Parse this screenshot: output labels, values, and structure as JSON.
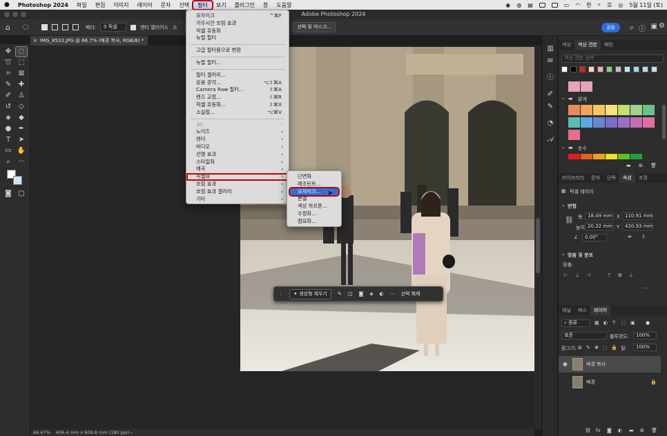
{
  "mac_menu": {
    "apple": "",
    "items": [
      "Photoshop 2024",
      "파일",
      "편집",
      "이미지",
      "레이어",
      "문자",
      "선택",
      "필터",
      "보기",
      "플러그인",
      "창",
      "도움말"
    ],
    "active_index": 7,
    "right": {
      "battery": "",
      "date": "5월 11일 (토)"
    }
  },
  "window_title": "Adobe Photoshop 2024",
  "options_bar": {
    "feather_label": "페더:",
    "feather_value": "0 픽셀",
    "antialias_label": "앤티 앨리어스",
    "style_abbr": "스",
    "select_mask_button": "선택 및 마스크...",
    "share_button": "공유"
  },
  "document": {
    "tab_title": "IMG_8533.JPG @ 66.7% (배경 복사, RGB/8) *",
    "zoom": "66.67%",
    "size_info": "406.4 mm x 609.6 mm (180 ppi)"
  },
  "filter_menu": {
    "items": [
      {
        "label": "모자이크",
        "shortcut": "^⌘F"
      },
      {
        "label": "가우시안 흐림 효과",
        "shortcut": ""
      },
      {
        "label": "픽셀 유동화",
        "shortcut": ""
      },
      {
        "label": "뉴럴 필터",
        "shortcut": ""
      },
      {
        "sep": true
      },
      {
        "label": "고급 필터용으로 변환",
        "shortcut": ""
      },
      {
        "sep": true
      },
      {
        "label": "뉴럴 필터...",
        "shortcut": ""
      },
      {
        "sep": true
      },
      {
        "label": "필터 갤러리...",
        "shortcut": ""
      },
      {
        "label": "응용 광각...",
        "shortcut": "⌥⇧⌘A"
      },
      {
        "label": "Camera Raw 필터...",
        "shortcut": "⇧⌘A"
      },
      {
        "label": "렌즈 교정...",
        "shortcut": "⇧⌘R"
      },
      {
        "label": "픽셀 유동화...",
        "shortcut": "⇧⌘X"
      },
      {
        "label": "소실점...",
        "shortcut": "⌥⌘V"
      },
      {
        "sep": true
      },
      {
        "label": "3D",
        "submenu": true,
        "disabled": true
      },
      {
        "label": "노이즈",
        "submenu": true
      },
      {
        "label": "렌더",
        "submenu": true
      },
      {
        "label": "비디오",
        "submenu": true
      },
      {
        "label": "선명 효과",
        "submenu": true
      },
      {
        "label": "스타일화",
        "submenu": true
      },
      {
        "label": "왜곡",
        "submenu": true
      },
      {
        "label": "픽셀화",
        "submenu": true,
        "highlighted": true
      },
      {
        "label": "흐림 효과",
        "submenu": true
      },
      {
        "label": "흐림 효과 갤러리",
        "submenu": true
      },
      {
        "label": "기타",
        "submenu": true
      }
    ]
  },
  "pixelate_submenu": {
    "items": [
      {
        "label": "단면화"
      },
      {
        "label": "메조틴트..."
      },
      {
        "label": "모자이크...",
        "selected": true
      },
      {
        "label": "분열"
      },
      {
        "label": "색상 하프톤..."
      },
      {
        "label": "수정화..."
      },
      {
        "label": "점묘화..."
      }
    ]
  },
  "context_bar": {
    "generative_fill": "생성형 채우기",
    "deselect": "선택 해제",
    "more": "···"
  },
  "swatches_panel": {
    "tabs": [
      "색상",
      "색상 견본",
      "패턴"
    ],
    "active_tab": 1,
    "search_placeholder": "색상 견본 검색",
    "top_colors": [
      "#ffffff",
      "#000000",
      "#d62020",
      "#f6d9b0",
      "#f4a7b9",
      "#7fd27f",
      "#c0c0c0",
      "#bfe3f5",
      "#a6d4f0",
      "#b9d9ee",
      "#c7e0f4"
    ],
    "groups": [
      {
        "name": "밝게",
        "colors": [
          "#ea8a5c",
          "#f0a55a",
          "#f6c85f",
          "#f6e27a",
          "#c4de6f",
          "#9fd28a",
          "#6bc28a",
          "#5bbfb0",
          "#5ba9de",
          "#6b86d0",
          "#7a6fc4",
          "#9a6fc4",
          "#c46fb4",
          "#e06fa0",
          "#e46f8a"
        ]
      },
      {
        "name": "순수",
        "colors": [
          "#e02020",
          "#e06020",
          "#f0a020",
          "#f0e020",
          "#60c020",
          "#20a040"
        ]
      }
    ]
  },
  "properties_panel": {
    "tabs": [
      "라이브러리",
      "문자",
      "단락",
      "속성",
      "조정"
    ],
    "active_tab": 3,
    "layer_type": "픽셀 레이어",
    "transform_title": "변형",
    "w_label": "폭",
    "w_value": "18.49 mm",
    "x_label": "X",
    "x_value": "110.91 mm",
    "h_label": "높이",
    "h_value": "20.32 mm",
    "y_label": "Y",
    "y_value": "420.93 mm",
    "angle_value": "0.00°",
    "align_title": "맞춤 및 분포",
    "align_label": "맞춤:",
    "more": "···"
  },
  "layers_panel": {
    "tabs": [
      "채널",
      "패스",
      "레이어"
    ],
    "active_tab": 2,
    "kind_label": "종류",
    "blend_mode": "표준",
    "opacity_label": "불투명도:",
    "opacity_value": "100%",
    "lock_label": "잠그기:",
    "fill_label": "칠:",
    "fill_value": "100%",
    "layers": [
      {
        "name": "배경 복사",
        "visible": true,
        "selected": true
      },
      {
        "name": "배경",
        "visible": false,
        "locked": true
      }
    ]
  }
}
